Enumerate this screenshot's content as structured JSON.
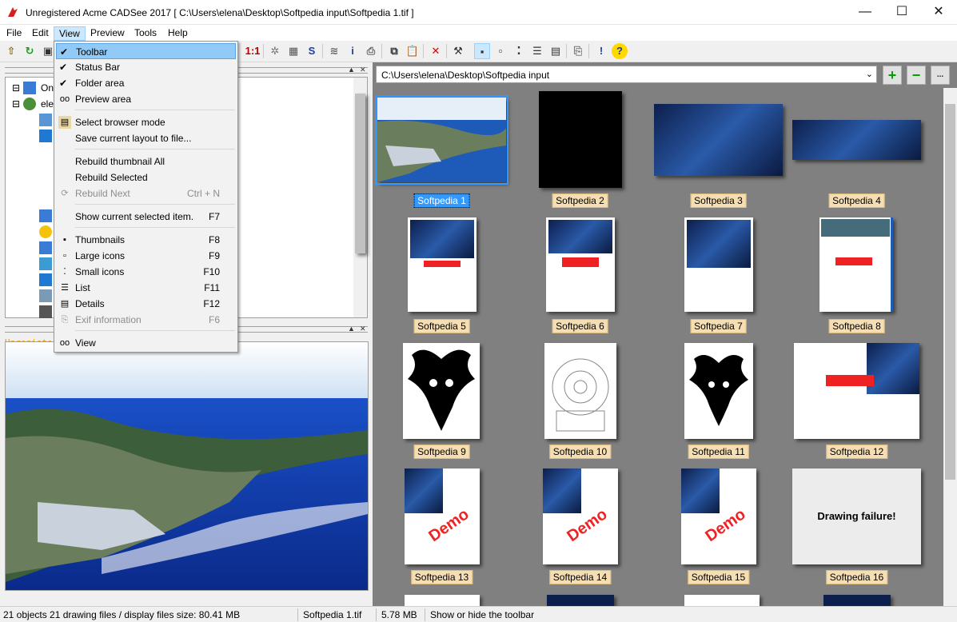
{
  "window": {
    "title": "Unregistered Acme CADSee 2017 [ C:\\Users\\elena\\Desktop\\Softpedia input\\Softpedia 1.tif ]",
    "minimize": "—",
    "maximize": "☐",
    "close": "✕"
  },
  "menubar": [
    "File",
    "Edit",
    "View",
    "Preview",
    "Tools",
    "Help"
  ],
  "tree": {
    "nodes": [
      "On",
      "ele"
    ]
  },
  "preview": {
    "watermark": "Unregistered"
  },
  "view_menu": {
    "items": [
      {
        "label": "Toolbar",
        "shortcut": "",
        "checked": true
      },
      {
        "label": "Status Bar",
        "shortcut": "",
        "checked": true
      },
      {
        "label": "Folder area",
        "shortcut": "",
        "checked": true
      },
      {
        "label": "Preview area",
        "shortcut": "",
        "checked": false
      },
      {
        "label": "Select browser mode",
        "shortcut": ""
      },
      {
        "label": "Save current layout to file...",
        "shortcut": ""
      },
      {
        "label": "Rebuild thumbnail All",
        "shortcut": ""
      },
      {
        "label": "Rebuild Selected",
        "shortcut": ""
      },
      {
        "label": "Rebuild Next",
        "shortcut": "Ctrl + N",
        "disabled": true
      },
      {
        "label": "Show current selected item.",
        "shortcut": "F7"
      },
      {
        "label": "Thumbnails",
        "shortcut": "F8"
      },
      {
        "label": "Large icons",
        "shortcut": "F9"
      },
      {
        "label": "Small icons",
        "shortcut": "F10"
      },
      {
        "label": "List",
        "shortcut": "F11"
      },
      {
        "label": "Details",
        "shortcut": "F12"
      },
      {
        "label": "Exif information",
        "shortcut": "F6",
        "disabled": true
      },
      {
        "label": "View",
        "shortcut": ""
      }
    ]
  },
  "browser": {
    "path": "C:\\Users\\elena\\Desktop\\Softpedia input",
    "thumbnails": [
      "Softpedia 1",
      "Softpedia 2",
      "Softpedia 3",
      "Softpedia 4",
      "Softpedia 5",
      "Softpedia 6",
      "Softpedia 7",
      "Softpedia 8",
      "Softpedia 9",
      "Softpedia 10",
      "Softpedia 11",
      "Softpedia 12",
      "Softpedia 13",
      "Softpedia 14",
      "Softpedia 15",
      "Softpedia 16"
    ],
    "drawing_failure": "Drawing failure!",
    "demo_stamp": "Demo"
  },
  "statusbar": {
    "summary": "21 objects 21 drawing files / display files size: 80.41 MB",
    "filename": "Softpedia 1.tif",
    "filesize": "5.78 MB",
    "hint": "Show or hide the toolbar"
  },
  "colors": {
    "selection": "#3399ff",
    "caption_bg": "#f5deb3",
    "browser_bg": "#808080"
  }
}
